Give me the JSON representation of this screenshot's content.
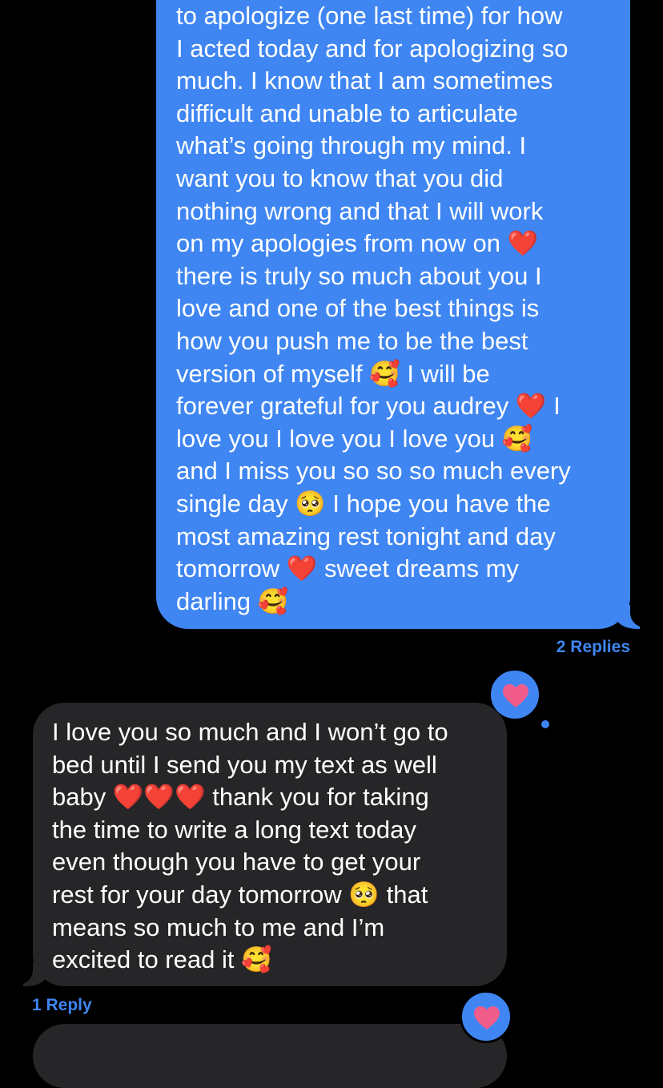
{
  "messages": {
    "outgoing": {
      "text": "to apologize (one last time) for how\nI acted today and for apologizing so\nmuch. I know that I am sometimes\ndifficult and unable to articulate\nwhat’s going through my mind. I\nwant you to know that you did\nnothing wrong and that I will work\non my apologies from now on ❤️\nthere is truly so much about you I\nlove and one of the best things is\nhow you push me to be the best\nversion of myself 🥰 I will be\nforever grateful for you audrey ❤️ I\nlove you I love you I love you 🥰\nand I miss you so so so much every\nsingle day 🥺 I hope you have the\nmost amazing rest tonight and day\ntomorrow ❤️ sweet dreams my\ndarling 🥰",
      "replies_label": "2 Replies"
    },
    "incoming": {
      "text": "I love you so much and I won’t go to\nbed until I send you my text as well\nbaby ❤️❤️❤️ thank you for taking\nthe time to write a long text today\neven though you have to get your\nrest for your day tomorrow 🥺 that\nmeans so much to me and I’m\nexcited to read it 🥰",
      "replies_label": "1 Reply"
    }
  },
  "tapbacks": [
    {
      "icon": "heart-icon",
      "color": "#3f86f2",
      "heart_color": "#f25c8a"
    },
    {
      "icon": "heart-icon",
      "color": "#3f86f2",
      "heart_color": "#f25c8a"
    }
  ],
  "colors": {
    "outgoing_bubble": "#3f86f2",
    "incoming_bubble": "#262628",
    "background": "#000000",
    "reply_link": "#3f86f2"
  }
}
